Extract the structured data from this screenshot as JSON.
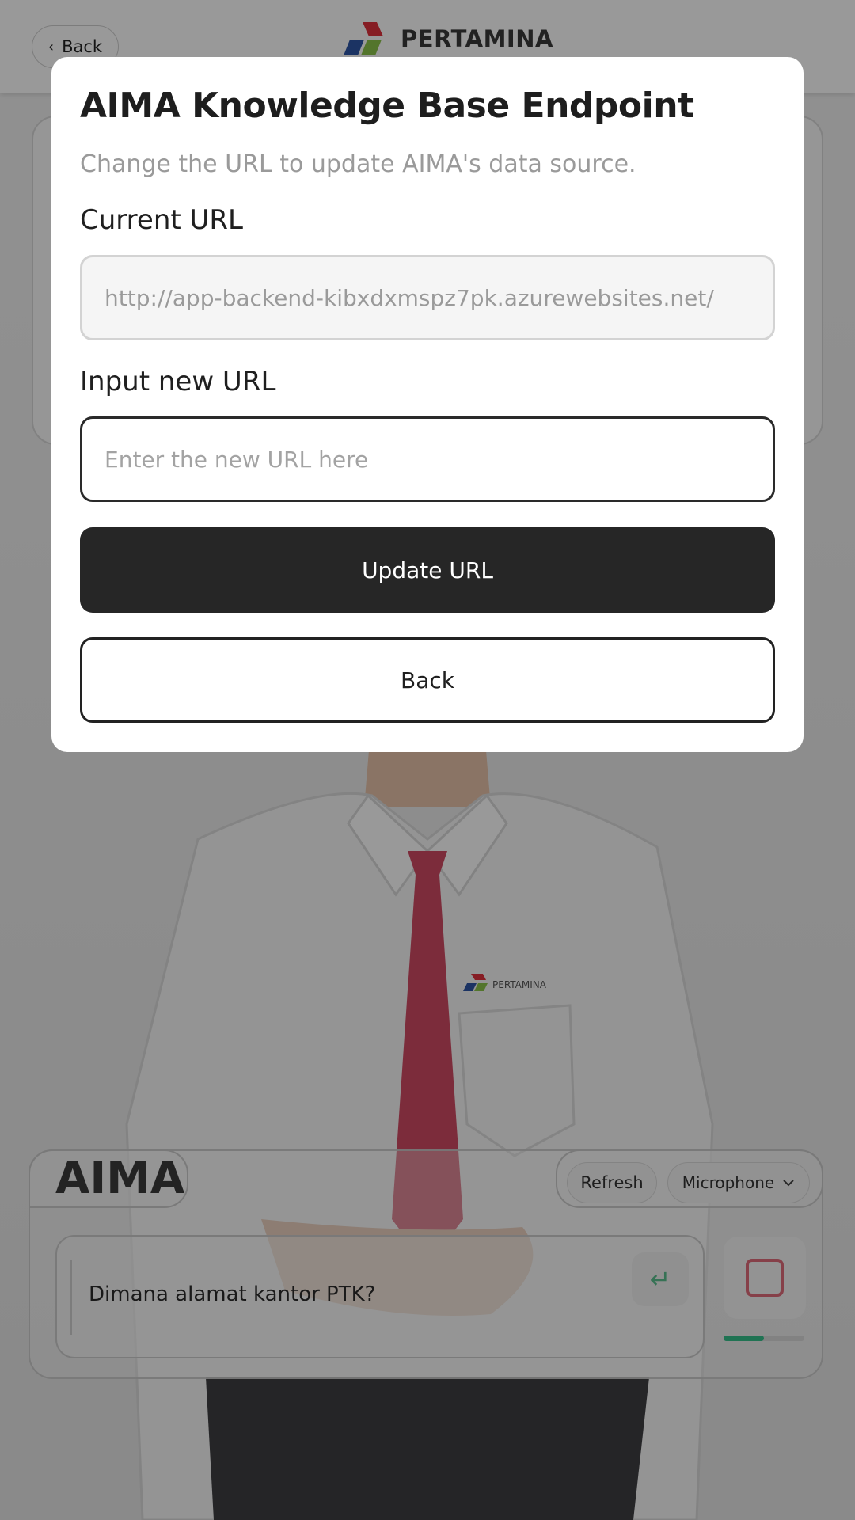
{
  "header": {
    "back_label": "Back",
    "brand_name": "PERTAMINA"
  },
  "assistant": {
    "name": "AIMA",
    "refresh_label": "Refresh",
    "microphone_label": "Microphone",
    "chat_text": "Dimana alamat kantor PTK?",
    "send_icon": "return-arrow-icon",
    "stop_icon": "stop-square-icon",
    "mic_level": 0.5,
    "colors": {
      "send": "#5bbf8e",
      "stop": "#e06b7b",
      "level": "#36c08a"
    }
  },
  "dialog": {
    "title": "AIMA Knowledge Base Endpoint",
    "subtitle": "Change the URL to update AIMA's data source.",
    "current_label": "Current URL",
    "current_value": "http://app-backend-kibxdxmspz7pk.azurewebsites.net/",
    "new_label": "Input new URL",
    "new_placeholder": "Enter the new URL here",
    "new_value": "",
    "update_button": "Update URL",
    "back_button": "Back"
  }
}
